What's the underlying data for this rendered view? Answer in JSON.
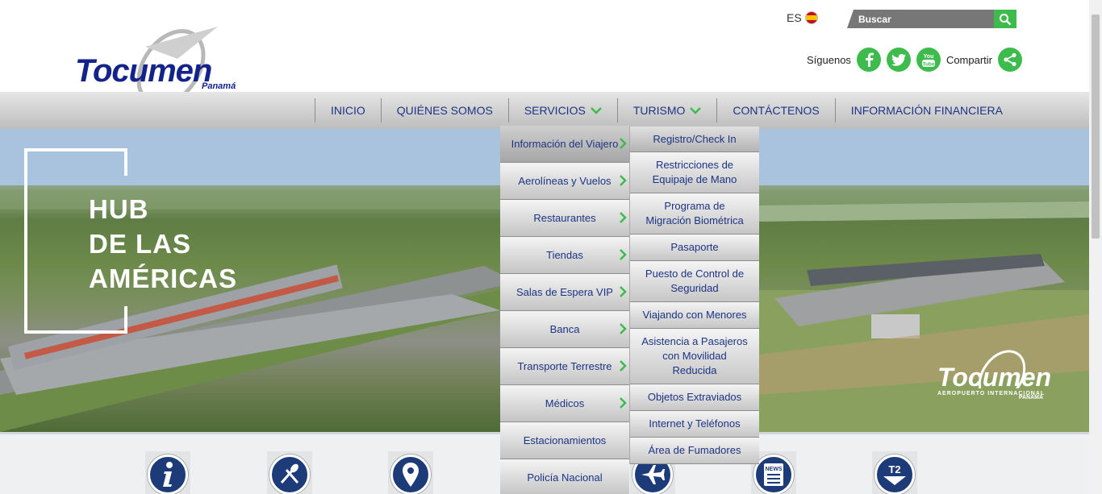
{
  "header": {
    "logo": {
      "word": "Tocumen",
      "sub": "Panamá"
    },
    "language": {
      "code": "ES"
    },
    "search": {
      "placeholder": "Buscar"
    },
    "social": {
      "follow_label": "Síguenos",
      "share_label": "Compartir",
      "icons": [
        "facebook-icon",
        "twitter-icon",
        "youtube-icon",
        "share-icon"
      ]
    }
  },
  "nav": {
    "items": [
      {
        "label": "INICIO"
      },
      {
        "label": "QUIÉNES SOMOS"
      },
      {
        "label": "SERVICIOS"
      },
      {
        "label": "TURISMO"
      },
      {
        "label": "CONTÁCTENOS"
      },
      {
        "label": "INFORMACIÓN FINANCIERA"
      }
    ]
  },
  "services_menu": {
    "items": [
      {
        "label": "Información del Viajero"
      },
      {
        "label": "Aerolíneas y Vuelos"
      },
      {
        "label": "Restaurantes"
      },
      {
        "label": "Tiendas"
      },
      {
        "label": "Salas de Espera VIP"
      },
      {
        "label": "Banca"
      },
      {
        "label": "Transporte Terrestre"
      },
      {
        "label": "Médicos"
      },
      {
        "label": "Estacionamientos"
      },
      {
        "label": "Policía Nacional"
      }
    ]
  },
  "traveler_submenu": {
    "items": [
      {
        "label": "Registro/Check In"
      },
      {
        "label": "Restricciones de\nEquipaje de Mano"
      },
      {
        "label": "Programa de\nMigración Biométrica"
      },
      {
        "label": "Pasaporte"
      },
      {
        "label": "Puesto de Control de\nSeguridad"
      },
      {
        "label": "Viajando con Menores"
      },
      {
        "label": "Asistencia a Pasajeros\ncon Movilidad\nReducida"
      },
      {
        "label": "Objetos Extraviados"
      },
      {
        "label": "Internet y Teléfonos"
      },
      {
        "label": "Área de Fumadores"
      }
    ]
  },
  "hero": {
    "line1": "HUB",
    "line2": "DE LAS",
    "line3": "AMÉRICAS",
    "logo_word": "Tocumen",
    "logo_sub": "AEROPUERTO INTERNACIONAL",
    "logo_country": "PANAMA"
  },
  "quick_links": {
    "icons": [
      "info-icon",
      "restaurant-icon",
      "location-icon",
      "flight-icon",
      "news-icon",
      "t2-icon"
    ],
    "news_label": "NEWS",
    "t2_label": "T2"
  },
  "colors": {
    "accent_green": "#3dbb4c",
    "brand_blue": "#13238a",
    "nav_text": "#1c3484"
  }
}
